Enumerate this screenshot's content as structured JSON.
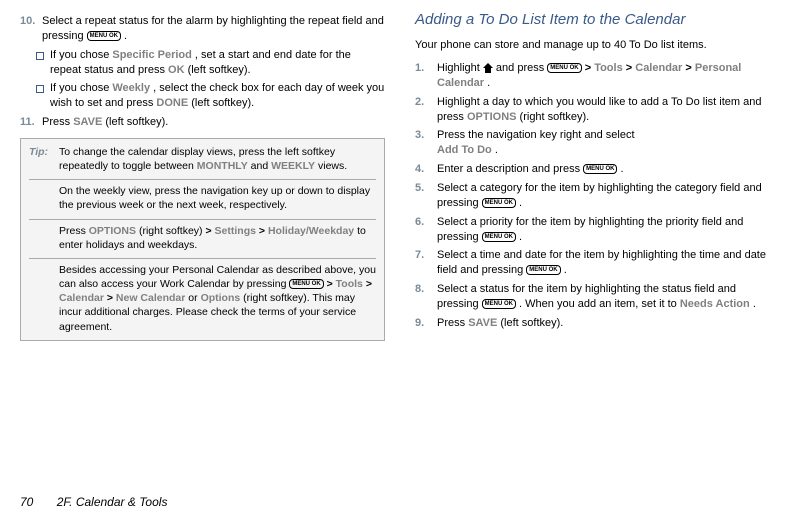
{
  "footer": {
    "page_num": "70",
    "section": "2F. Calendar & Tools"
  },
  "key_label": "MENU\nOK",
  "left": {
    "step10": {
      "num": "10.",
      "body_a": "Select a repeat status for the alarm by highlighting the repeat field and pressing ",
      "body_b": "."
    },
    "bullet_a": {
      "pre": "If you chose ",
      "opt": "Specific Period",
      "mid": ", set a start and end date for the repeat status and press ",
      "btn": "OK",
      "post": " (left softkey)."
    },
    "bullet_b": {
      "pre": "If you chose ",
      "opt": "Weekly",
      "mid": ", select the check box for each day of week you wish to set and press ",
      "btn": "DONE",
      "post": " (left softkey)."
    },
    "step11": {
      "num": "11.",
      "pre": "Press ",
      "btn": "SAVE",
      "post": " (left softkey)."
    },
    "tip": {
      "label": "Tip:",
      "p1a": "To change the calendar display views, press the left softkey repeatedly to toggle between ",
      "p1b": "MONTHLY",
      "p1c": " and ",
      "p1d": "WEEKLY",
      "p1e": " views.",
      "p2": "On the weekly view, press the navigation key up or down to display the previous week or the next week, respectively.",
      "p3a": "Press ",
      "p3b": "OPTIONS",
      "p3c": " (right softkey) ",
      "p3d": "Settings",
      "p3e": "Holiday/Weekday",
      "p3f": " to enter holidays and weekdays.",
      "p4a": "Besides accessing your Personal Calendar as described above, you can also access your Work Calendar by pressing ",
      "p4b": "Tools",
      "p4c": "Calendar",
      "p4d": "New Calendar",
      "p4e": " or ",
      "p4f": "Options",
      "p4g": " (right softkey). This may incur additional charges. Please check the terms of your service agreement."
    }
  },
  "right": {
    "heading": "Adding a To Do List Item to the Calendar",
    "intro": "Your phone can store and manage up to 40 To Do list items.",
    "s1": {
      "num": "1.",
      "a": "Highlight ",
      "b": " and press ",
      "t1": "Tools",
      "t2": "Calendar",
      "t3": "Personal Calendar",
      "end": "."
    },
    "s2": {
      "num": "2.",
      "a": "Highlight a day to which you would like to add a To Do list item and press ",
      "btn": "OPTIONS",
      "b": " (right softkey)."
    },
    "s3": {
      "num": "3.",
      "a": "Press the navigation key right and select ",
      "btn": "Add To Do",
      "b": "."
    },
    "s4": {
      "num": "4.",
      "a": "Enter a description and press ",
      "b": "."
    },
    "s5": {
      "num": "5.",
      "a": "Select a category for the item by highlighting the category field and pressing ",
      "b": "."
    },
    "s6": {
      "num": "6.",
      "a": "Select a priority for the item by highlighting the priority field and pressing ",
      "b": "."
    },
    "s7": {
      "num": "7.",
      "a": "Select a time and date for the item by highlighting the time and date field and pressing ",
      "b": "."
    },
    "s8": {
      "num": "8.",
      "a": "Select a status for the item by highlighting the status field and pressing ",
      "b": ". When you add an item, set it to ",
      "btn": "Needs Action",
      "c": "."
    },
    "s9": {
      "num": "9.",
      "a": "Press ",
      "btn": "SAVE",
      "b": " (left softkey)."
    }
  }
}
